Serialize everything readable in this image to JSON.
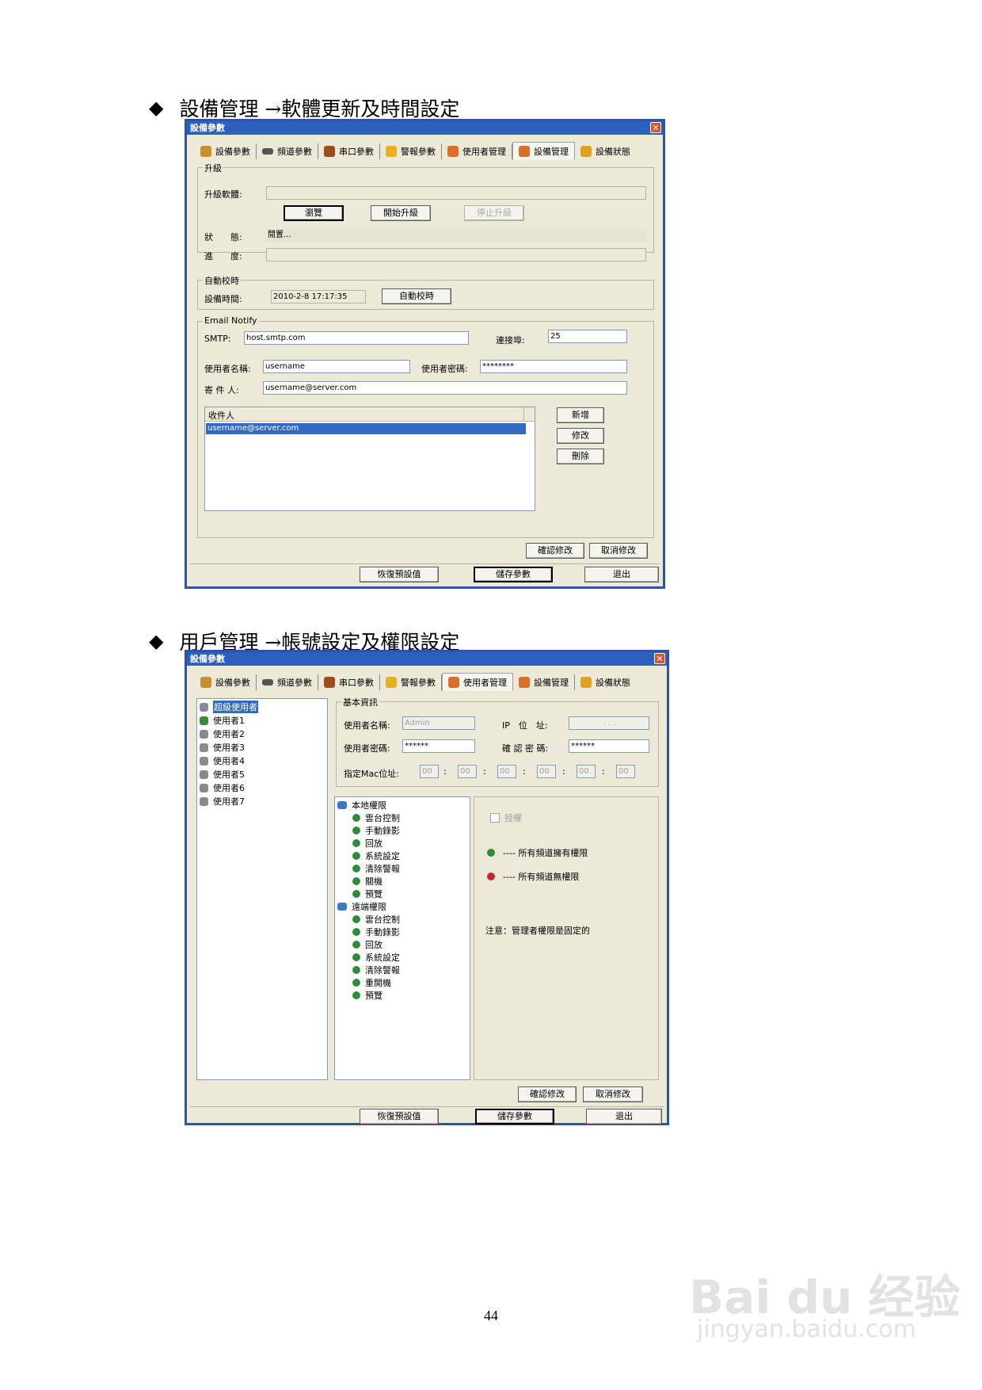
{
  "section1": {
    "heading": "設備管理 →軟體更新及時間設定",
    "dialog": {
      "title": "設備參數",
      "close": "✕",
      "tabs": [
        "設備參數",
        "頻道參數",
        "串口參數",
        "警報參數",
        "使用者管理",
        "設備管理",
        "設備狀態"
      ],
      "active_tab": "設備管理",
      "upgrade": {
        "legend": "升級",
        "software_label": "升級軟體:",
        "software_value": "",
        "browse": "瀏覽",
        "start": "開始升級",
        "stop": "停止升級",
        "status_label": "狀　　態:",
        "status_value": "閒置...",
        "progress_label": "進　　度:",
        "progress_value": ""
      },
      "autotime": {
        "legend": "自動校時",
        "time_label": "設備時間:",
        "time_value": "2010-2-8 17:17:35",
        "button": "自動校時"
      },
      "email": {
        "legend": "Email Notify",
        "smtp_label": "SMTP:",
        "smtp_value": "host.smtp.com",
        "port_label": "連接埠:",
        "port_value": "25",
        "user_label": "使用者名稱:",
        "user_value": "username",
        "pass_label": "使用者密碼:",
        "pass_value": "********",
        "sender_label": "寄 件 人:",
        "sender_value": "username@server.com",
        "recipients_header": "收件人",
        "recipients": [
          "username@server.com"
        ],
        "add": "新增",
        "edit": "修改",
        "delete": "刪除"
      },
      "confirm": "確認修改",
      "cancel": "取消修改",
      "restore": "恢復預設值",
      "save": "儲存參數",
      "exit": "退出"
    }
  },
  "section2": {
    "heading": "用戶管理 →帳號設定及權限設定",
    "dialog": {
      "title": "設備參數",
      "close": "✕",
      "tabs": [
        "設備參數",
        "頻道參數",
        "串口參數",
        "警報參數",
        "使用者管理",
        "設備管理",
        "設備狀態"
      ],
      "active_tab": "使用者管理",
      "users": [
        "超級使用者",
        "使用者1",
        "使用者2",
        "使用者3",
        "使用者4",
        "使用者5",
        "使用者6",
        "使用者7"
      ],
      "basic": {
        "legend": "基本資訊",
        "name_label": "使用者名稱:",
        "name_value": "Admin",
        "ip_label": "IP　位　址:",
        "ip_value": ".  .  .",
        "pass_label": "使用者密碼:",
        "pass_value": "******",
        "confirm_label": "確 認 密 碼:",
        "confirm_value": "******",
        "mac_label": "指定Mac位址:",
        "mac_values": [
          "00",
          "00",
          "00",
          "00",
          "00",
          "00"
        ],
        "mac_sep": ":"
      },
      "tree": {
        "local_label": "本地權限",
        "local_items": [
          "雲台控制",
          "手動錄影",
          "回放",
          "系統設定",
          "清除警報",
          "關機",
          "預覽"
        ],
        "remote_label": "遠端權限",
        "remote_items": [
          "雲台控制",
          "手動錄影",
          "回放",
          "系統設定",
          "清除警報",
          "重開機",
          "預覽"
        ]
      },
      "auth_label": "授權",
      "legend_all": "---- 所有頻道擁有權限",
      "legend_none": "---- 所有頻道無權限",
      "note": "注意：管理者權限是固定的",
      "confirm": "確認修改",
      "cancel": "取消修改",
      "restore": "恢復預設值",
      "save": "儲存參數",
      "exit": "退出"
    }
  },
  "page_number": "44",
  "watermark": {
    "brand": "Bai du 经验",
    "url": "jingyan.baidu.com"
  },
  "colors": {
    "titlebar": "#2d5fbf",
    "dialog_bg": "#ece9d8",
    "selection": "#316ac5",
    "green_dot": "#2e8b3a",
    "red_dot": "#c0282a"
  }
}
